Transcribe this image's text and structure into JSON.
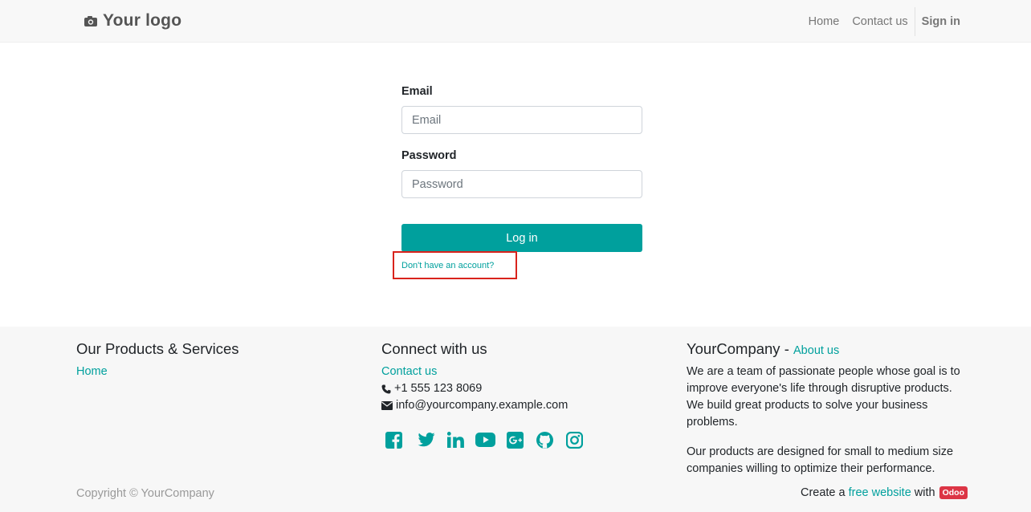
{
  "header": {
    "logo_text": "Your logo",
    "nav": [
      "Home",
      "Contact us"
    ],
    "signin": "Sign in"
  },
  "login": {
    "email_label": "Email",
    "email_placeholder": "Email",
    "email_value": "",
    "password_label": "Password",
    "password_placeholder": "Password",
    "password_value": "",
    "login_button": "Log in",
    "signup_link": "Don't have an account?"
  },
  "footer": {
    "col1": {
      "title": "Our Products & Services",
      "links": [
        "Home"
      ]
    },
    "col2": {
      "title": "Connect with us",
      "contact_link": "Contact us",
      "phone": "+1 555 123 8069",
      "email": "info@yourcompany.example.com",
      "social_icons": [
        "facebook-icon",
        "twitter-icon",
        "linkedin-icon",
        "youtube-icon",
        "google-plus-icon",
        "github-icon",
        "instagram-icon"
      ]
    },
    "col3": {
      "title": "YourCompany",
      "title_sep": " - ",
      "about_link": "About us",
      "para1": "We are a team of passionate people whose goal is to improve everyone's life through disruptive products. We build great products to solve your business problems.",
      "para2": "Our products are designed for small to medium size companies willing to optimize their performance."
    },
    "copyright": "Copyright © YourCompany",
    "create_prefix": "Create a",
    "create_link": "free website",
    "create_with": "with",
    "badge": "Odoo"
  },
  "colors": {
    "accent": "#00a09d",
    "highlight_border": "#d9231c",
    "badge": "#dc3545"
  }
}
